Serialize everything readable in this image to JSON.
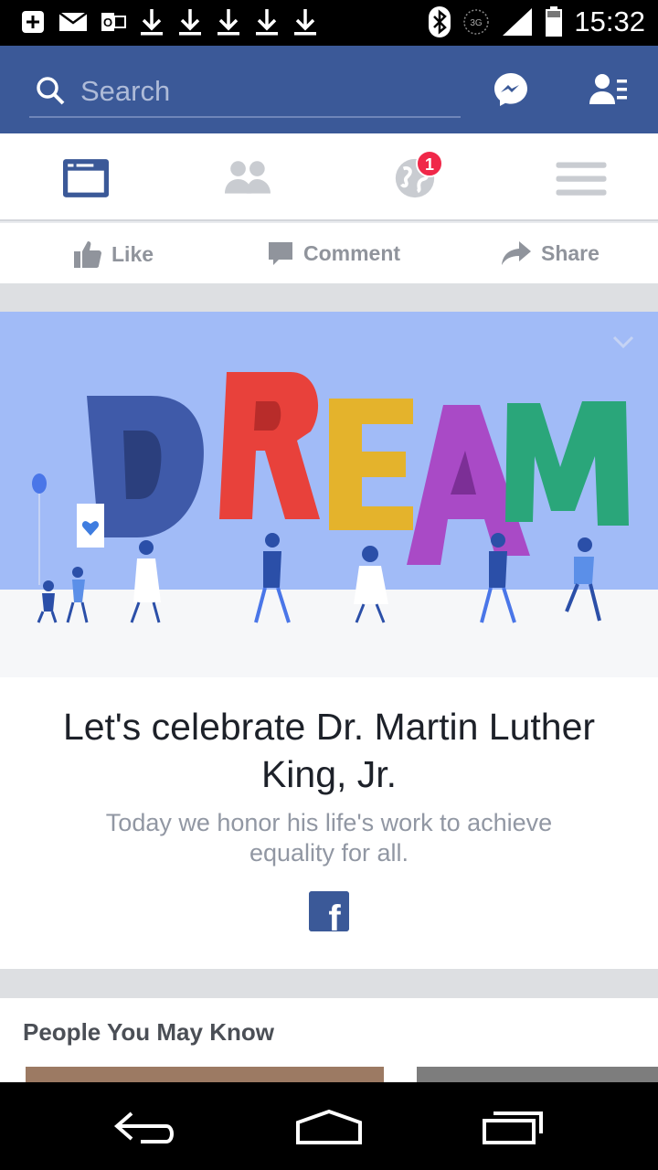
{
  "status_bar": {
    "time": "15:32",
    "network_label": "3G",
    "icons": [
      "add-icon",
      "mail-icon",
      "outlook-icon",
      "download-icon",
      "download-icon",
      "download-icon",
      "download-icon",
      "download-icon",
      "bluetooth-icon",
      "3g-icon",
      "signal-icon",
      "battery-icon"
    ]
  },
  "top_bar": {
    "search_placeholder": "Search",
    "background": "#3b5998",
    "icons": [
      "messenger-icon",
      "friend-requests-icon"
    ]
  },
  "nav_tabs": [
    {
      "name": "news-feed",
      "icon": "news-feed-icon",
      "active": true
    },
    {
      "name": "friends",
      "icon": "friends-icon",
      "active": false
    },
    {
      "name": "notifications",
      "icon": "globe-icon",
      "badge": "1",
      "active": false
    },
    {
      "name": "menu",
      "icon": "menu-icon",
      "active": false
    }
  ],
  "actions": {
    "like": "Like",
    "comment": "Comment",
    "share": "Share"
  },
  "card": {
    "illustration_text": "DREAM",
    "headline": "Let's celebrate Dr. Martin Luther King, Jr.",
    "subtext": "Today we honor his life's work to achieve equality for all.",
    "logo_glyph": "f"
  },
  "people_you_may_know": {
    "title": "People You May Know"
  },
  "colors": {
    "brand": "#3b5998",
    "badge": "#f02849",
    "letter_d": "#3f5aa9",
    "letter_r": "#e8413b",
    "letter_e": "#e4b32c",
    "letter_a": "#a94ac6",
    "letter_m": "#2aa67a"
  }
}
